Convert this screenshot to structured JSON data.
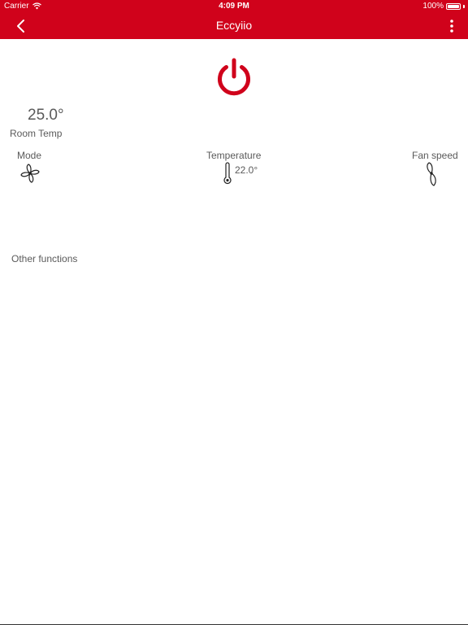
{
  "status_bar": {
    "carrier": "Carrier",
    "time": "4:09 PM",
    "battery": "100%",
    "wifi_icon": "wifi-icon",
    "battery_icon": "battery-icon",
    "battery_level": 1.0
  },
  "nav": {
    "title": "Eccyiio",
    "back_icon": "chevron-left-icon",
    "more_icon": "more-vertical-icon"
  },
  "power": {
    "icon": "power-icon"
  },
  "room": {
    "temp_value": "25.0°",
    "temp_label": "Room Temp"
  },
  "controls": {
    "mode_label": "Mode",
    "mode_icon": "fan-blades-icon",
    "temperature_label": "Temperature",
    "temperature_icon": "thermometer-icon",
    "set_temp": "22.0°",
    "fan_speed_label": "Fan speed",
    "fan_speed_icon": "fan-speed-icon"
  },
  "other_functions": "Other functions",
  "colors": {
    "accent": "#d0021b",
    "text": "#5a5a5a",
    "background": "#ffffff"
  }
}
